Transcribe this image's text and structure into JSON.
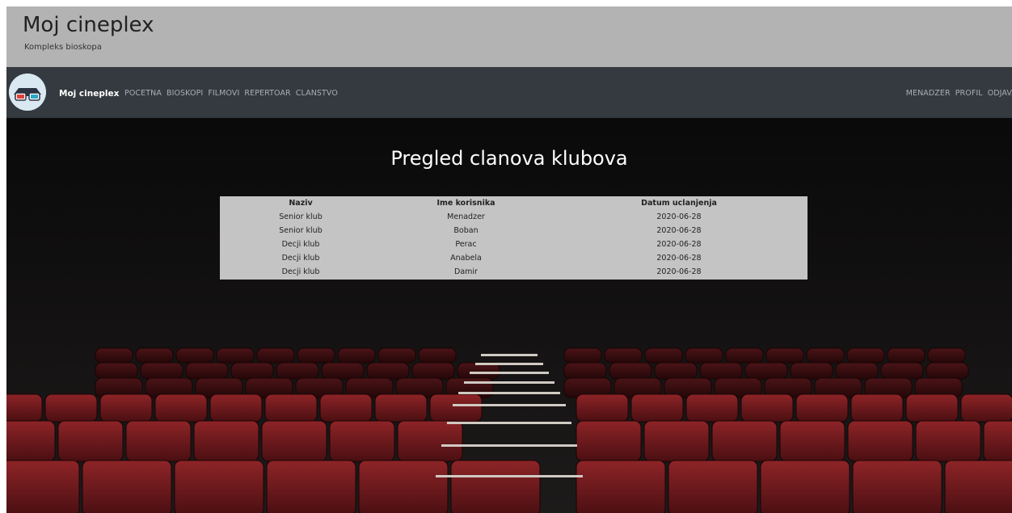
{
  "header": {
    "title": "Moj cineplex",
    "subtitle": "Kompleks bioskopa"
  },
  "navbar": {
    "brand": "Moj cineplex",
    "links_left": [
      "POCETNA",
      "BIOSKOPI",
      "FILMOVI",
      "REPERTOAR",
      "CLANSTVO"
    ],
    "links_right": [
      "MENADZER",
      "PROFIL",
      "ODJAVA"
    ]
  },
  "main": {
    "heading": "Pregled clanova klubova",
    "table": {
      "headers": [
        "Naziv",
        "Ime korisnika",
        "Datum uclanjenja"
      ],
      "rows": [
        [
          "Senior klub",
          "Menadzer",
          "2020-06-28"
        ],
        [
          "Senior klub",
          "Boban",
          "2020-06-28"
        ],
        [
          "Decji klub",
          "Perac",
          "2020-06-28"
        ],
        [
          "Decji klub",
          "Anabela",
          "2020-06-28"
        ],
        [
          "Decji klub",
          "Damir",
          "2020-06-28"
        ]
      ]
    }
  },
  "colors": {
    "jumbotron": "#b3b3b3",
    "navbar": "#343a40",
    "table_bg": "#c4c4c4",
    "seat_red": "#7a1b1e"
  },
  "icons": {
    "logo": "3d-glasses-icon"
  }
}
